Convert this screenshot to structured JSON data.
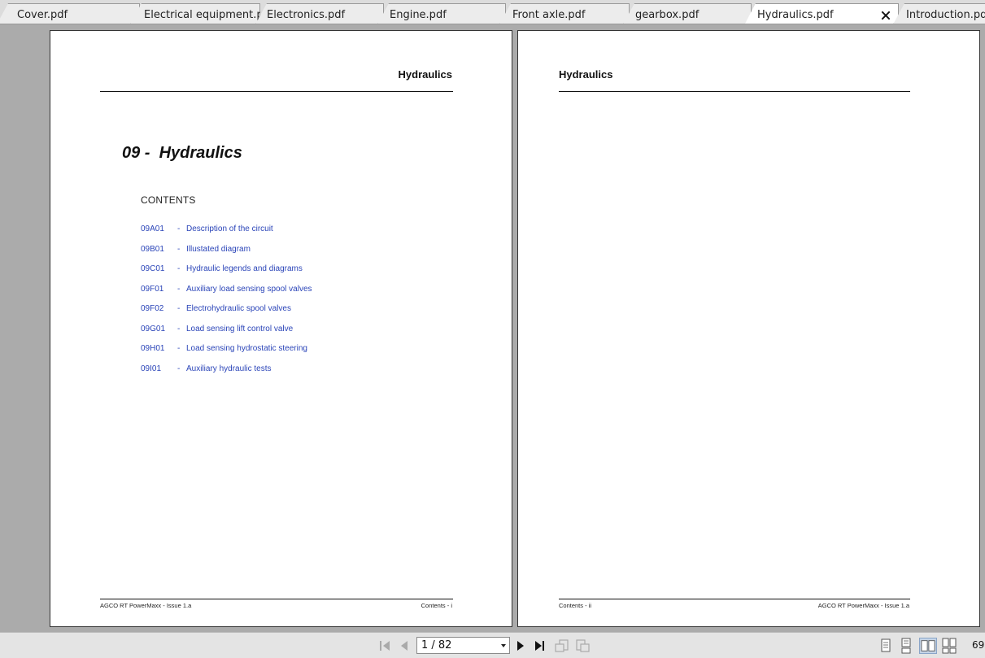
{
  "tabs": [
    {
      "label": "Cover.pdf"
    },
    {
      "label": "Electrical equipment.pdf"
    },
    {
      "label": "Electronics.pdf"
    },
    {
      "label": "Engine.pdf"
    },
    {
      "label": "Front axle.pdf"
    },
    {
      "label": "gearbox.pdf"
    },
    {
      "label": "Hydraulics.pdf",
      "active": true
    },
    {
      "label": "Introduction.pdf"
    }
  ],
  "left_page": {
    "header": "Hydraulics",
    "chapter_title": "09 -  Hydraulics",
    "contents_heading": "CONTENTS",
    "toc": [
      {
        "code": "09A01",
        "sep": "-",
        "title": "Description of the circuit"
      },
      {
        "code": "09B01",
        "sep": "-",
        "title": "Illustated diagram"
      },
      {
        "code": "09C01",
        "sep": "-",
        "title": "Hydraulic legends and diagrams"
      },
      {
        "code": "09F01",
        "sep": "-",
        "title": "Auxiliary load sensing spool valves"
      },
      {
        "code": "09F02",
        "sep": "-",
        "title": "Electrohydraulic spool valves"
      },
      {
        "code": "09G01",
        "sep": "-",
        "title": "Load sensing lift control valve"
      },
      {
        "code": "09H01",
        "sep": "-",
        "title": "Load sensing hydrostatic steering"
      },
      {
        "code": "09I01",
        "sep": "-",
        "title": "Auxiliary hydraulic tests"
      }
    ],
    "footer_left": "AGCO RT PowerMaxx - Issue 1.a",
    "footer_right": "Contents - i"
  },
  "right_page": {
    "header": "Hydraulics",
    "footer_left": "Contents - ii",
    "footer_right": "AGCO RT PowerMaxx - Issue 1.a"
  },
  "toolbar": {
    "page_indicator": "1 / 82",
    "zoom": "69"
  },
  "icons": {
    "first_page": "first-page-icon",
    "prev_page": "prev-page-icon",
    "next_page": "next-page-icon",
    "last_page": "last-page-icon",
    "back": "history-back-icon",
    "forward": "history-forward-icon",
    "single_page": "single-page-icon",
    "continuous": "continuous-page-icon",
    "facing": "facing-pages-icon",
    "facing_continuous": "facing-continuous-icon",
    "close_tab": "close-icon"
  },
  "colors": {
    "link": "#2a44b8",
    "background": "#ababab"
  }
}
